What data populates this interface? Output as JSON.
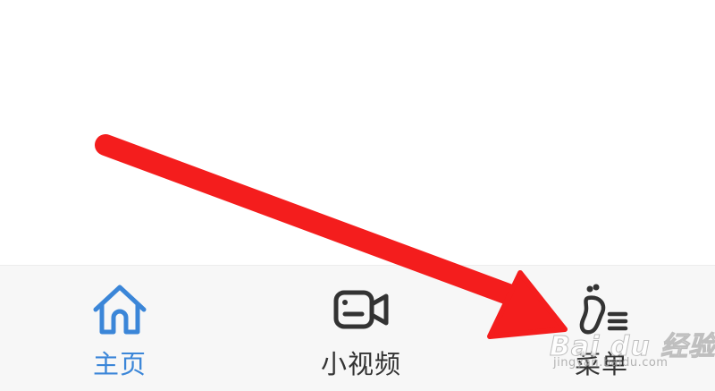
{
  "tabbar": {
    "tabs": [
      {
        "label": "主页",
        "icon": "home-icon",
        "active": true
      },
      {
        "label": "小视频",
        "icon": "video-camera-icon",
        "active": false
      },
      {
        "label": "菜单",
        "icon": "footprint-menu-icon",
        "active": false
      }
    ]
  },
  "annotation": {
    "type": "red-arrow",
    "color": "#f41d1d",
    "points_to": "菜单"
  },
  "watermark": {
    "text": "Bai du 经验",
    "sub": "jingyan.baidu.com"
  },
  "colors": {
    "active": "#3b86d8",
    "inactive": "#333333",
    "tabbar_bg": "#f7f7f7",
    "arrow": "#f41d1d"
  }
}
